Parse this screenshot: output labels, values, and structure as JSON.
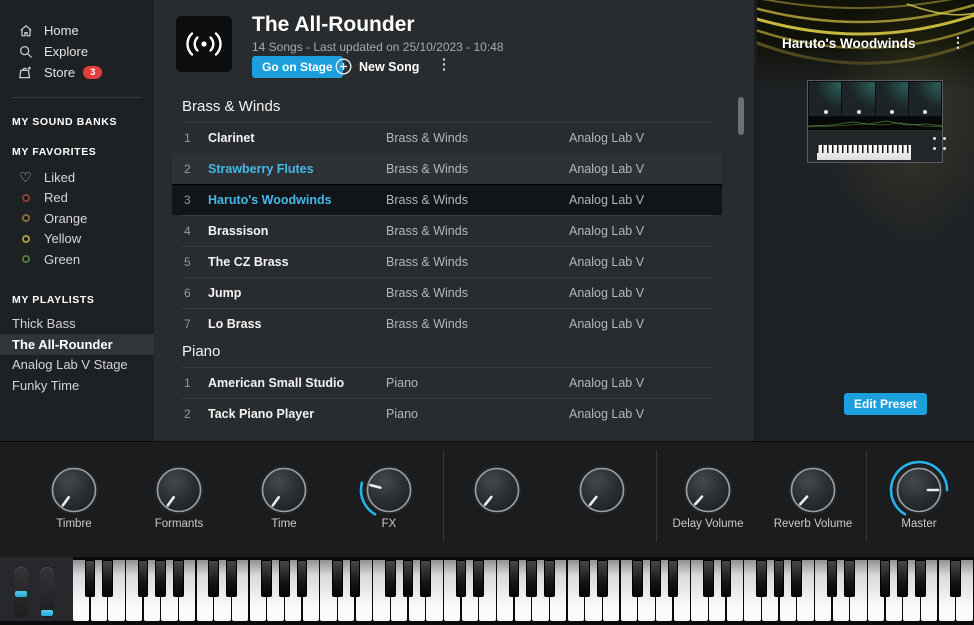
{
  "sidebar": {
    "nav": [
      {
        "label": "Home",
        "icon": "home-icon"
      },
      {
        "label": "Explore",
        "icon": "search-icon"
      },
      {
        "label": "Store",
        "icon": "store-icon",
        "badge": "3"
      }
    ],
    "sound_banks_header": "MY SOUND BANKS",
    "favorites_header": "MY FAVORITES",
    "favorites": [
      {
        "label": "Liked",
        "icon": "heart-icon"
      },
      {
        "label": "Red",
        "color": "#8a4038"
      },
      {
        "label": "Orange",
        "color": "#8a683a"
      },
      {
        "label": "Yellow",
        "color": "#a89a3a"
      },
      {
        "label": "Green",
        "color": "#557a40"
      }
    ],
    "playlists_header": "MY PLAYLISTS",
    "playlists": [
      {
        "label": "Thick Bass",
        "selected": false
      },
      {
        "label": "The All-Rounder",
        "selected": true
      },
      {
        "label": "Analog Lab V Stage",
        "selected": false
      },
      {
        "label": "Funky Time",
        "selected": false
      }
    ]
  },
  "header": {
    "title": "The All-Rounder",
    "subtitle": "14 Songs - Last updated on 25/10/2023 - 10:48",
    "go_on_stage": "Go on Stage",
    "new_song": "New Song"
  },
  "song_list": {
    "sections": [
      {
        "title": "Brass & Winds",
        "rows": [
          {
            "num": "1",
            "name": "Clarinet",
            "type": "Brass & Winds",
            "bank": "Analog Lab V",
            "state": "normal"
          },
          {
            "num": "2",
            "name": "Strawberry Flutes",
            "type": "Brass & Winds",
            "bank": "Analog Lab V",
            "state": "hover"
          },
          {
            "num": "3",
            "name": "Haruto's Woodwinds",
            "type": "Brass & Winds",
            "bank": "Analog Lab V",
            "state": "selected"
          },
          {
            "num": "4",
            "name": "Brassison",
            "type": "Brass & Winds",
            "bank": "Analog Lab V",
            "state": "normal"
          },
          {
            "num": "5",
            "name": "The CZ Brass",
            "type": "Brass & Winds",
            "bank": "Analog Lab V",
            "state": "normal"
          },
          {
            "num": "6",
            "name": "Jump",
            "type": "Brass & Winds",
            "bank": "Analog Lab V",
            "state": "normal"
          },
          {
            "num": "7",
            "name": "Lo Brass",
            "type": "Brass & Winds",
            "bank": "Analog Lab V",
            "state": "normal"
          }
        ]
      },
      {
        "title": "Piano",
        "rows": [
          {
            "num": "1",
            "name": "American Small Studio",
            "type": "Piano",
            "bank": "Analog Lab V",
            "state": "normal"
          },
          {
            "num": "2",
            "name": "Tack Piano Player",
            "type": "Piano",
            "bank": "Analog Lab V",
            "state": "normal"
          }
        ]
      }
    ]
  },
  "preset_panel": {
    "title": "Haruto's Woodwinds",
    "edit_button": "Edit Preset"
  },
  "controls": {
    "knobs": [
      {
        "label": "Timbre",
        "value": 0.02,
        "arc": false
      },
      {
        "label": "Formants",
        "value": 0.02,
        "arc": false
      },
      {
        "label": "Time",
        "value": 0.02,
        "arc": false
      },
      {
        "label": "FX",
        "value": 0.25,
        "arc": true
      },
      {
        "label": "",
        "value": 0.03,
        "arc": false
      },
      {
        "label": "",
        "value": 0.03,
        "arc": false
      },
      {
        "label": "Delay Volume",
        "value": 0.04,
        "arc": false
      },
      {
        "label": "Reverb Volume",
        "value": 0.04,
        "arc": false
      },
      {
        "label": "Master",
        "value": 0.8,
        "arc": true
      }
    ]
  },
  "colors": {
    "accent": "#1b9fdd",
    "highlight_text": "#45b9e6",
    "knob_arc": "#27b3e8",
    "badge": "#e23c3c"
  }
}
